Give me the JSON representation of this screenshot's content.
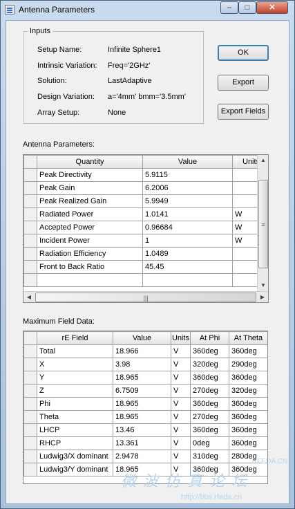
{
  "window": {
    "title": "Antenna Parameters"
  },
  "inputs": {
    "legend": "Inputs",
    "rows": [
      {
        "label": "Setup Name:",
        "value": "Infinite Sphere1"
      },
      {
        "label": "Intrinsic Variation:",
        "value": "Freq='2GHz'"
      },
      {
        "label": "Solution:",
        "value": "LastAdaptive"
      },
      {
        "label": "Design Variation:",
        "value": "a='4mm' bmm='3.5mm'"
      },
      {
        "label": "Array Setup:",
        "value": "None"
      }
    ]
  },
  "buttons": {
    "ok": "OK",
    "export": "Export",
    "export_fields": "Export Fields"
  },
  "antenna_params": {
    "label": "Antenna Parameters:",
    "columns": [
      "Quantity",
      "Value",
      "Units"
    ],
    "rows": [
      [
        "Peak Directivity",
        "5.9115",
        ""
      ],
      [
        "Peak Gain",
        "6.2006",
        ""
      ],
      [
        "Peak Realized Gain",
        "5.9949",
        ""
      ],
      [
        "Radiated Power",
        "1.0141",
        "W"
      ],
      [
        "Accepted Power",
        "0.96684",
        "W"
      ],
      [
        "Incident Power",
        "1",
        "W"
      ],
      [
        "Radiation Efficiency",
        "1.0489",
        ""
      ],
      [
        "Front to Back Ratio",
        "45.45",
        ""
      ]
    ]
  },
  "max_field": {
    "label": "Maximum Field Data:",
    "columns": [
      "rE Field",
      "Value",
      "Units",
      "At Phi",
      "At Theta"
    ],
    "rows": [
      [
        "Total",
        "18.966",
        "V",
        "360deg",
        "360deg"
      ],
      [
        "X",
        "3.98",
        "V",
        "320deg",
        "290deg"
      ],
      [
        "Y",
        "18.965",
        "V",
        "360deg",
        "360deg"
      ],
      [
        "Z",
        "6.7509",
        "V",
        "270deg",
        "320deg"
      ],
      [
        "Phi",
        "18.965",
        "V",
        "360deg",
        "360deg"
      ],
      [
        "Theta",
        "18.965",
        "V",
        "270deg",
        "360deg"
      ],
      [
        "LHCP",
        "13.46",
        "V",
        "360deg",
        "360deg"
      ],
      [
        "RHCP",
        "13.361",
        "V",
        "0deg",
        "360deg"
      ],
      [
        "Ludwig3/X dominant",
        "2.9478",
        "V",
        "310deg",
        "280deg"
      ],
      [
        "Ludwig3/Y dominant",
        "18.965",
        "V",
        "360deg",
        "360deg"
      ]
    ]
  },
  "watermark": {
    "line1": "微波仿真论坛",
    "line2": "http://bbs.rfeda.cn",
    "line3": "RFEDA.CN"
  }
}
